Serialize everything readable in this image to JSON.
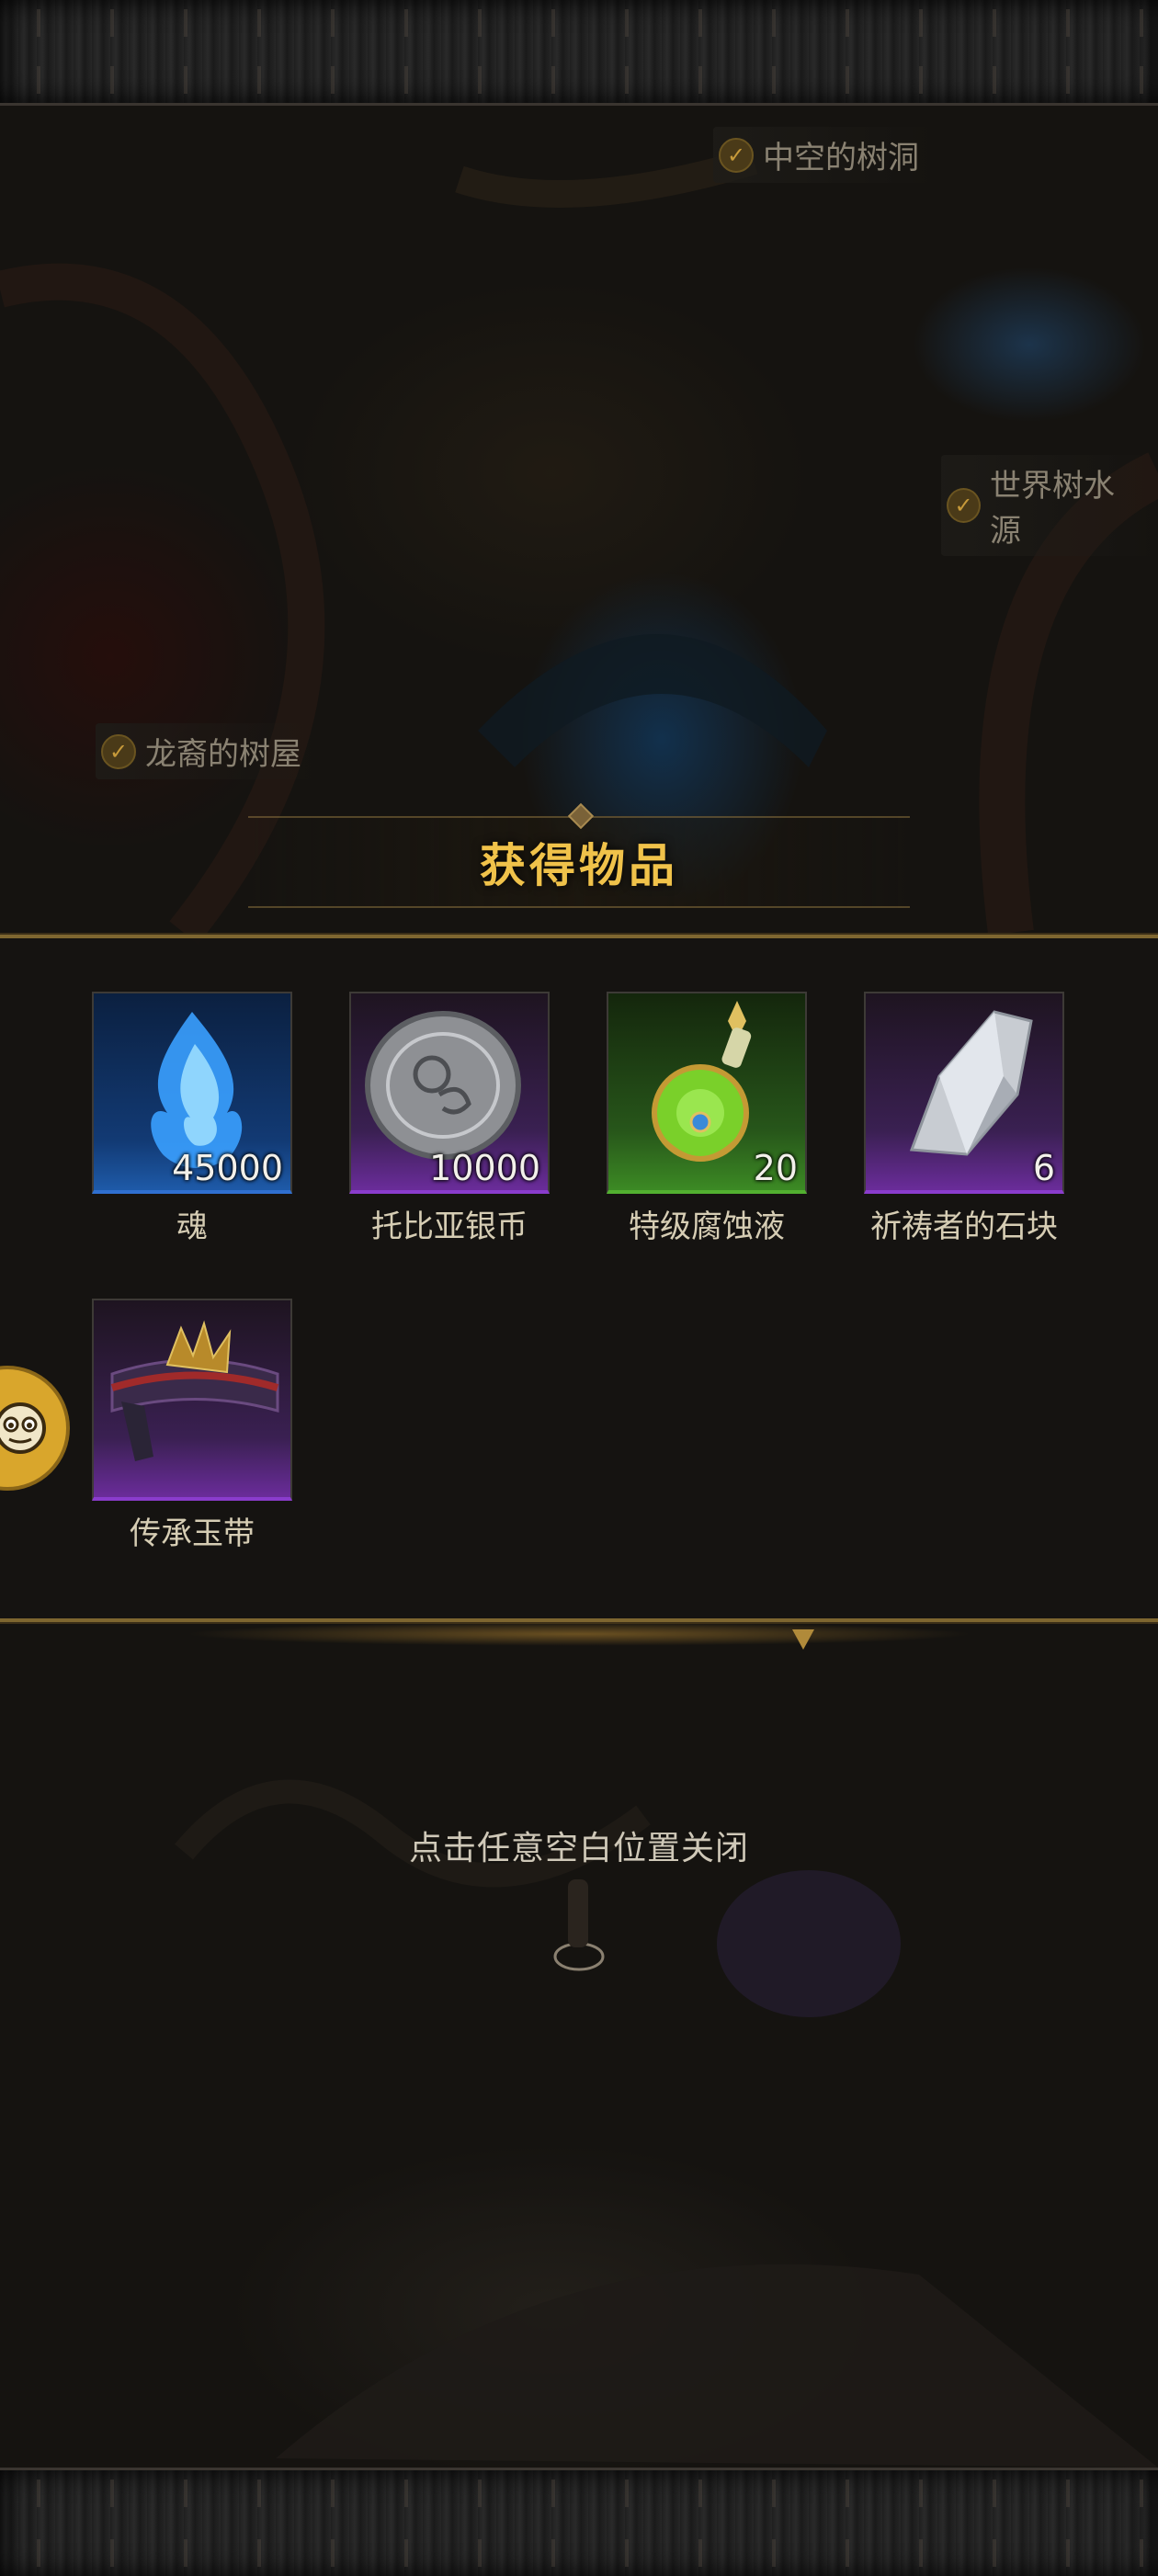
{
  "map_labels": {
    "hollow_tree": "中空的树洞",
    "world_tree_water": "世界树水源",
    "dragon_treehouse": "龙裔的树屋"
  },
  "dialog": {
    "title": "获得物品",
    "items": [
      {
        "name": "魂",
        "count": "45000",
        "rarity": "blue",
        "icon": "blue-soul-flame-icon"
      },
      {
        "name": "托比亚银币",
        "count": "10000",
        "rarity": "purple",
        "icon": "silver-coin-icon"
      },
      {
        "name": "特级腐蚀液",
        "count": "20",
        "rarity": "green",
        "icon": "green-potion-bottle-icon"
      },
      {
        "name": "祈祷者的石块",
        "count": "6",
        "rarity": "purple",
        "icon": "white-stone-icon"
      },
      {
        "name": "传承玉带",
        "count": "",
        "rarity": "purple",
        "icon": "ornate-belt-icon"
      }
    ],
    "close_hint": "点击任意空白位置关闭"
  },
  "colors": {
    "title_gold": "#f0c24a",
    "panel_border": "#7e6630",
    "rarity_blue": "#2f6fd0",
    "rarity_purple": "#8a3ccc",
    "rarity_green": "#52b030"
  }
}
